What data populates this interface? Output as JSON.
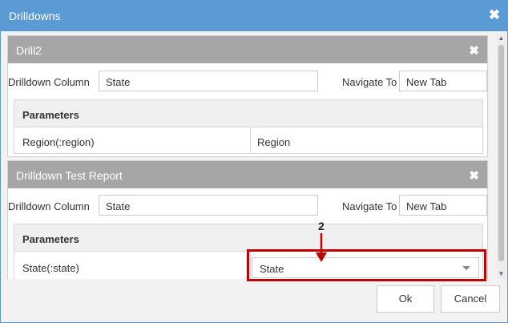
{
  "dialog": {
    "title": "Drilldowns",
    "close_glyph": "✖"
  },
  "drilldowns": [
    {
      "title": "Drill2",
      "close_glyph": "✖",
      "column_label": "Drilldown Column",
      "column_value": "State",
      "navigate_label": "Navigate To",
      "navigate_value": "New Tab",
      "params_header": "Parameters",
      "params": [
        {
          "name": "Region(:region)",
          "value": "Region"
        }
      ]
    },
    {
      "title": "Drilldown Test Report",
      "close_glyph": "✖",
      "column_label": "Drilldown Column",
      "column_value": "State",
      "navigate_label": "Navigate To",
      "navigate_value": "New Tab",
      "params_header": "Parameters",
      "params": [
        {
          "name": "State(:state)",
          "value": "State"
        }
      ]
    }
  ],
  "annotation": {
    "number": "2",
    "color": "#c00000"
  },
  "footer": {
    "ok_label": "Ok",
    "cancel_label": "Cancel"
  },
  "scrollbar": {
    "up_glyph": "▲",
    "down_glyph": "▼"
  },
  "colors": {
    "titlebar": "#5b9bd5",
    "panel_header": "#a6a6a6"
  }
}
